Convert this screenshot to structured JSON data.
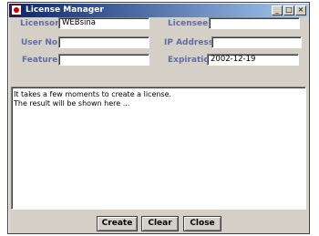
{
  "window": {
    "title": "License Manager",
    "controls": {
      "minimize": "_",
      "maximize": "□",
      "close": "×"
    }
  },
  "form": {
    "licensor": {
      "label": "Licensor",
      "value": "WEBsina"
    },
    "licensee": {
      "label": "Licensee",
      "value": ""
    },
    "user_no": {
      "label": "User No",
      "value": ""
    },
    "ip_address": {
      "label": "IP Address",
      "value": ""
    },
    "feature": {
      "label": "Feature",
      "value": ""
    },
    "expiration": {
      "label": "Expiration",
      "value": "2002-12-19"
    }
  },
  "output": {
    "lines": [
      "It takes a few moments to create a license.",
      "The result will be shown here ..."
    ]
  },
  "buttons": {
    "create": "Create",
    "clear": "Clear",
    "close": "Close"
  },
  "colors": {
    "label": "#636ba6",
    "titlebar_start": "#0a246a",
    "titlebar_end": "#a6caf0",
    "window_bg": "#d4d0c8"
  }
}
